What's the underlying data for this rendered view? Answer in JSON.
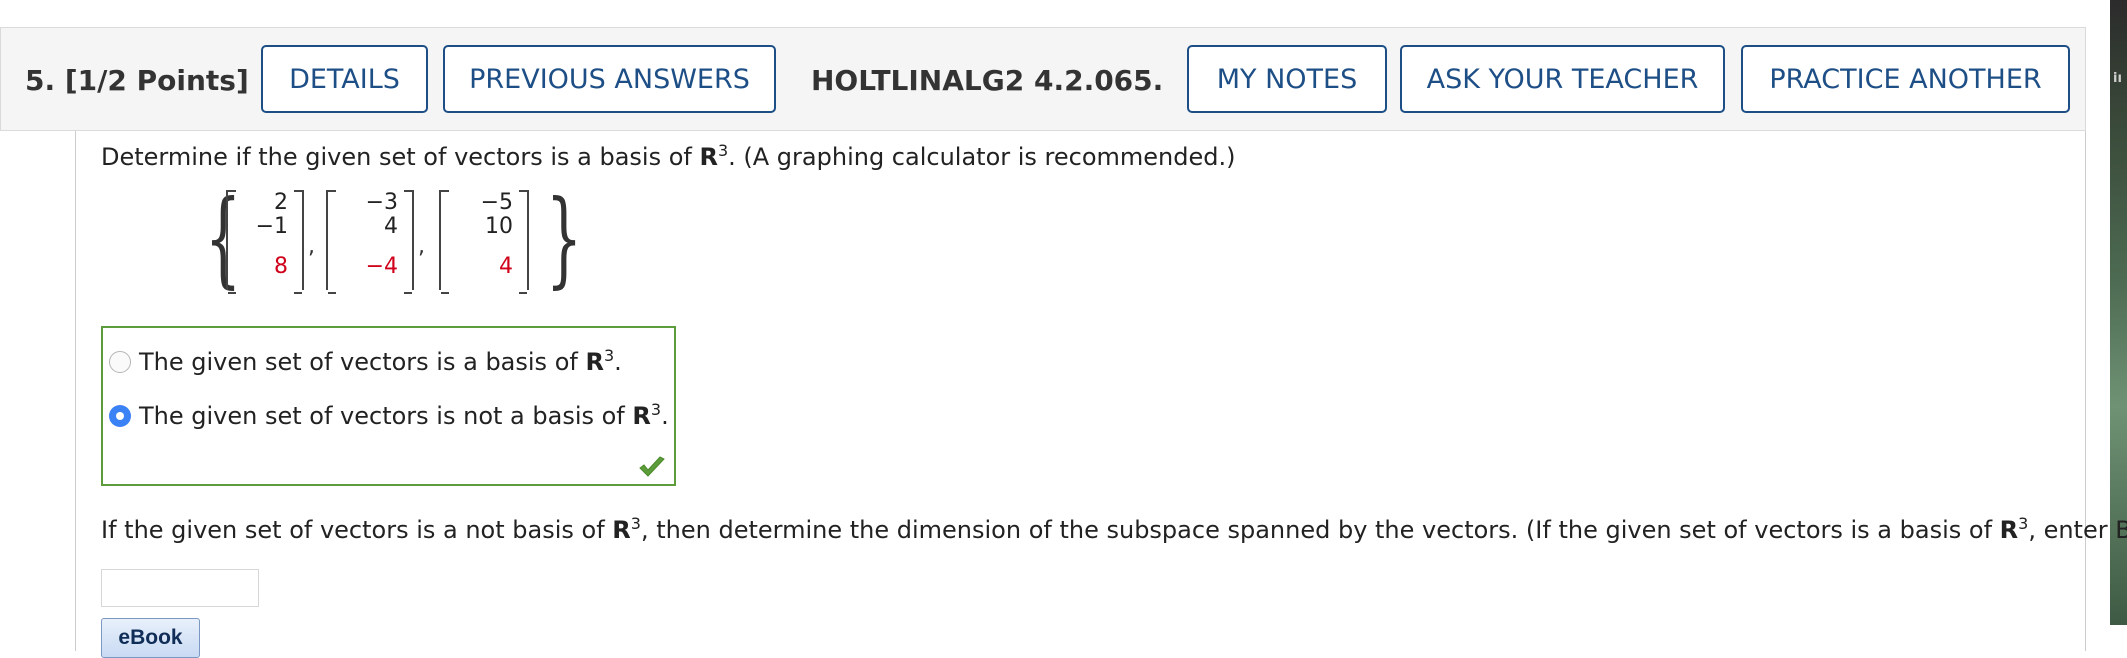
{
  "header": {
    "question_number": "5.",
    "points": "[1/2 Points]",
    "details_label": "DETAILS",
    "previous_answers_label": "PREVIOUS ANSWERS",
    "assignment_code": "HOLTLINALG2 4.2.065.",
    "my_notes_label": "MY NOTES",
    "ask_teacher_label": "ASK YOUR TEACHER",
    "practice_another_label": "PRACTICE ANOTHER"
  },
  "prompt": {
    "before": "Determine if the given set of vectors is a basis of ",
    "space": "R",
    "exp": "3",
    "after": ".  (A graphing calculator is recommended.)"
  },
  "vectors": [
    [
      "2",
      "−1",
      "8"
    ],
    [
      "−3",
      "4",
      "−4"
    ],
    [
      "−5",
      "10",
      "4"
    ]
  ],
  "options": [
    {
      "before": "The given set of vectors is a basis of ",
      "space": "R",
      "exp": "3",
      "after": ".",
      "selected": false
    },
    {
      "before": "The given set of vectors is not a basis of ",
      "space": "R",
      "exp": "3",
      "after": ".",
      "selected": true
    }
  ],
  "followup": {
    "p1": "If the given set of vectors is a not basis of ",
    "space1": "R",
    "exp1": "3",
    "p2": ", then determine the dimension of the subspace spanned by the vectors. (If the given set of vectors is a basis of ",
    "space2": "R",
    "exp2": "3",
    "p3": ", enter BASIS.)"
  },
  "answer_value": "",
  "ebook_label": "eBook",
  "colors": {
    "button_border": "#1d4f86",
    "correct_green": "#5c9c3a",
    "highlight_red": "#d0021b",
    "radio_selected": "#3b82f6"
  },
  "icons": {
    "correct": "checkmark-icon"
  }
}
